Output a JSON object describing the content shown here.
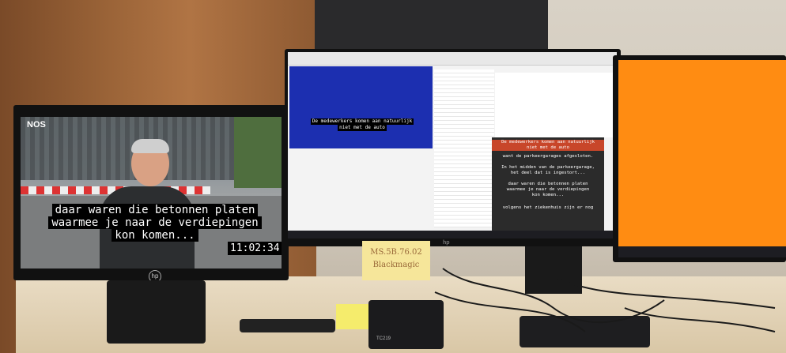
{
  "left_monitor": {
    "channel_logo": "NOS",
    "subtitle_lines": [
      "daar waren die betonnen platen",
      "waarmee je naar de verdiepingen",
      "kon komen..."
    ],
    "timecode": "11:02:34:12",
    "brand": "hp"
  },
  "center_monitor": {
    "video_subtitle_lines": [
      "De medewerkers komen aan natuurlijk",
      "niet met de auto"
    ],
    "captions": [
      "De medewerkers komen aan natuurlijk",
      "niet met de auto",
      "want de parkeergarages afgesloten.",
      "In het midden van de parkeergarage,",
      "het deel dat is ingestort...",
      "daar waren die betonnen platen",
      "waarmee je naar de verdiepingen",
      "kon komen...",
      "volgens het ziekenhuis zijn er nog"
    ],
    "brand": "hp"
  },
  "right_monitor": {
    "screen_color": "#ff8c12"
  },
  "sticky_note": {
    "lines": [
      "MS.5B.76.02",
      "Blackmagic"
    ]
  },
  "desk": {
    "device_label": "TC219"
  },
  "colors": {
    "video_blue": "#1c2fb0",
    "caption_bg": "#2b2b2b",
    "caption_highlight": "#c8462a"
  }
}
